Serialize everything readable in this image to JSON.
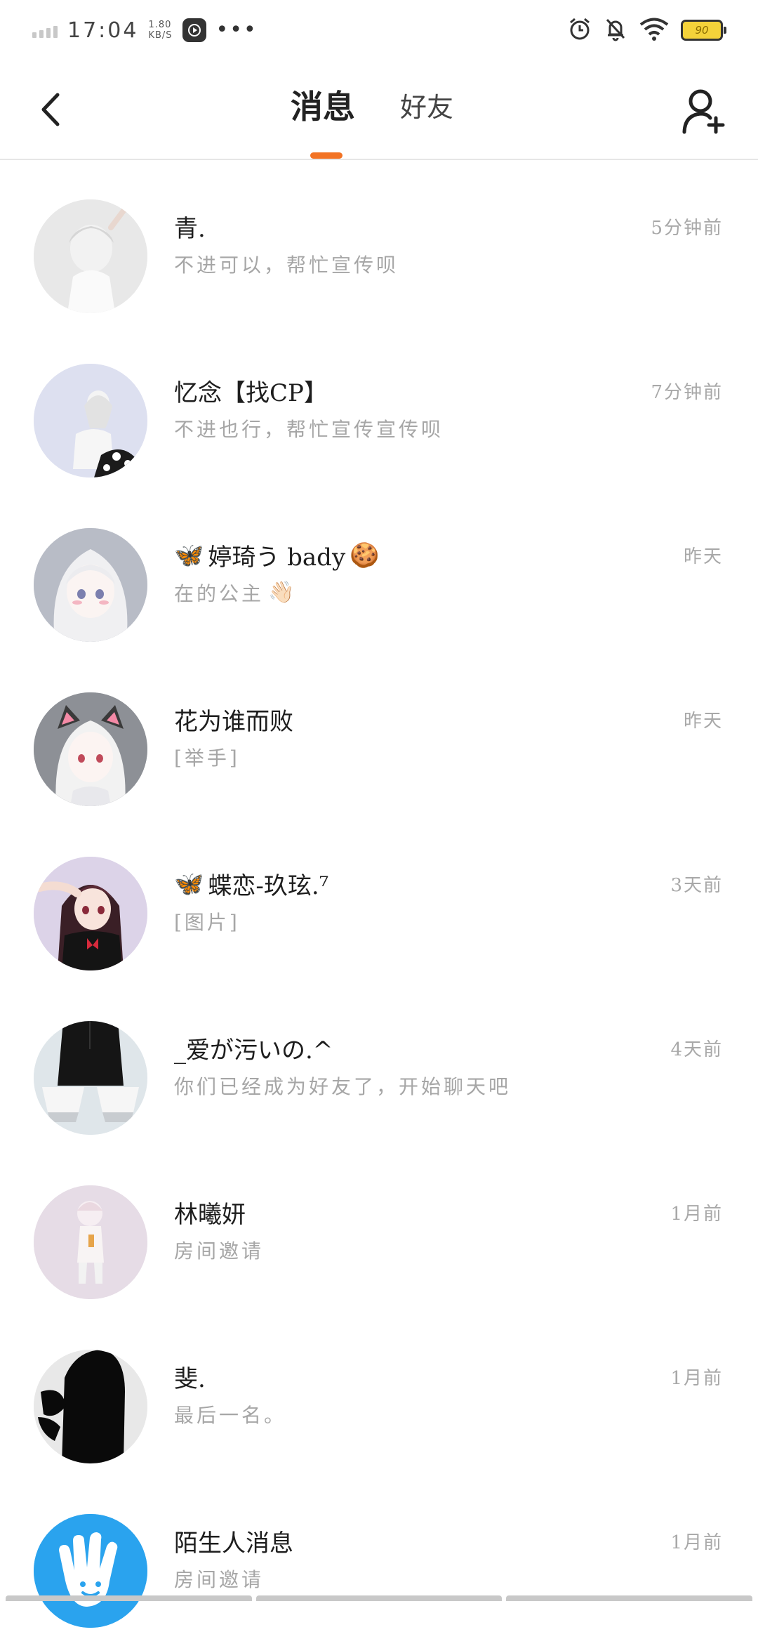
{
  "status_bar": {
    "time": "17:04",
    "net_speed_value": "1.80",
    "net_speed_unit": "KB/S",
    "battery": "90",
    "icons": [
      "signal-icon",
      "video-play-icon",
      "more-dots-icon",
      "alarm-icon",
      "mute-bell-icon",
      "wifi-icon",
      "battery-icon"
    ]
  },
  "header": {
    "back_icon": "chevron-left-icon",
    "tabs": [
      {
        "label": "消息",
        "active": true
      },
      {
        "label": "好友",
        "active": false
      }
    ],
    "add_friend_icon": "add-user-icon",
    "accent_color": "#f27324"
  },
  "messages": [
    {
      "name": "青.",
      "preview": "不进可以，帮忙宣传呗",
      "time": "5分钟前",
      "avatar_color": "#e6e6e6",
      "avatar_icon": "anime-avatar-white-hair"
    },
    {
      "name": "忆念【找CP】",
      "preview": "不进也行，帮忙宣传宣传呗",
      "time": "7分钟前",
      "avatar_color": "#dde0f0",
      "avatar_icon": "anime-avatar-cow-print"
    },
    {
      "name_prefix_emoji": "🦋",
      "name": "婷琦う bady",
      "name_suffix_emoji": "🍪",
      "preview": "在的公主",
      "preview_suffix_emoji": "👋🏻",
      "time": "昨天",
      "avatar_color": "#b8bcc6",
      "avatar_icon": "anime-avatar-silver-hair"
    },
    {
      "name": "花为谁而败",
      "preview": "[举手]",
      "time": "昨天",
      "avatar_color": "#8d9096",
      "avatar_icon": "anime-avatar-cat-ears"
    },
    {
      "name_prefix_emoji": "🦋",
      "name": "蝶恋-玖玹.⁷",
      "preview": "[图片]",
      "time": "3天前",
      "avatar_color": "#dcd3e8",
      "avatar_icon": "anime-avatar-red-bow"
    },
    {
      "name": "_爱が污いの.^",
      "preview": "你们已经成为好友了，开始聊天吧",
      "time": "4天前",
      "avatar_color": "#dfe6ea",
      "avatar_icon": "avatar-black-white-shapes"
    },
    {
      "name": "林曦妍",
      "preview": "房间邀请",
      "time": "1月前",
      "avatar_color": "#e6dce6",
      "avatar_icon": "anime-avatar-small-figure"
    },
    {
      "name": "斐.",
      "preview": "最后一名。",
      "time": "1月前",
      "avatar_color": "#e8e8e8",
      "avatar_icon": "avatar-black-silhouette"
    },
    {
      "name": "陌生人消息",
      "preview": "房间邀请",
      "time": "1月前",
      "avatar_color": "#2aa3ee",
      "avatar_icon": "waving-hand-icon"
    }
  ]
}
